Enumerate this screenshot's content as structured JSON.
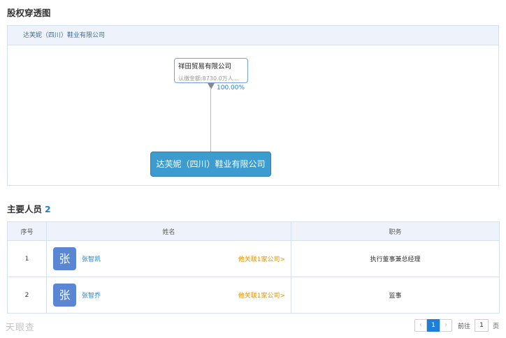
{
  "equity": {
    "title": "股权穿透图",
    "header_company": "达芙妮（四川）鞋业有限公司",
    "shareholder": {
      "name": "祥田贸易有限公司",
      "subscribed": "认缴金额:8730.0万人..."
    },
    "percent": "100.00%",
    "target": "达芙妮（四川）鞋业有限公司"
  },
  "personnel": {
    "title": "主要人员",
    "count": "2",
    "columns": [
      "序号",
      "姓名",
      "职务"
    ],
    "rows": [
      {
        "no": "1",
        "avatar": "张",
        "name": "张智凯",
        "related": "他关联1家公司>",
        "role": "执行董事兼总经理"
      },
      {
        "no": "2",
        "avatar": "张",
        "name": "张智乔",
        "related": "他关联1家公司>",
        "role": "监事"
      }
    ]
  },
  "pagination": {
    "prev": "‹",
    "current": "1",
    "next": "›",
    "goto_label": "前往",
    "goto_value": "1",
    "page_unit": "页"
  },
  "watermark": "天眼查"
}
